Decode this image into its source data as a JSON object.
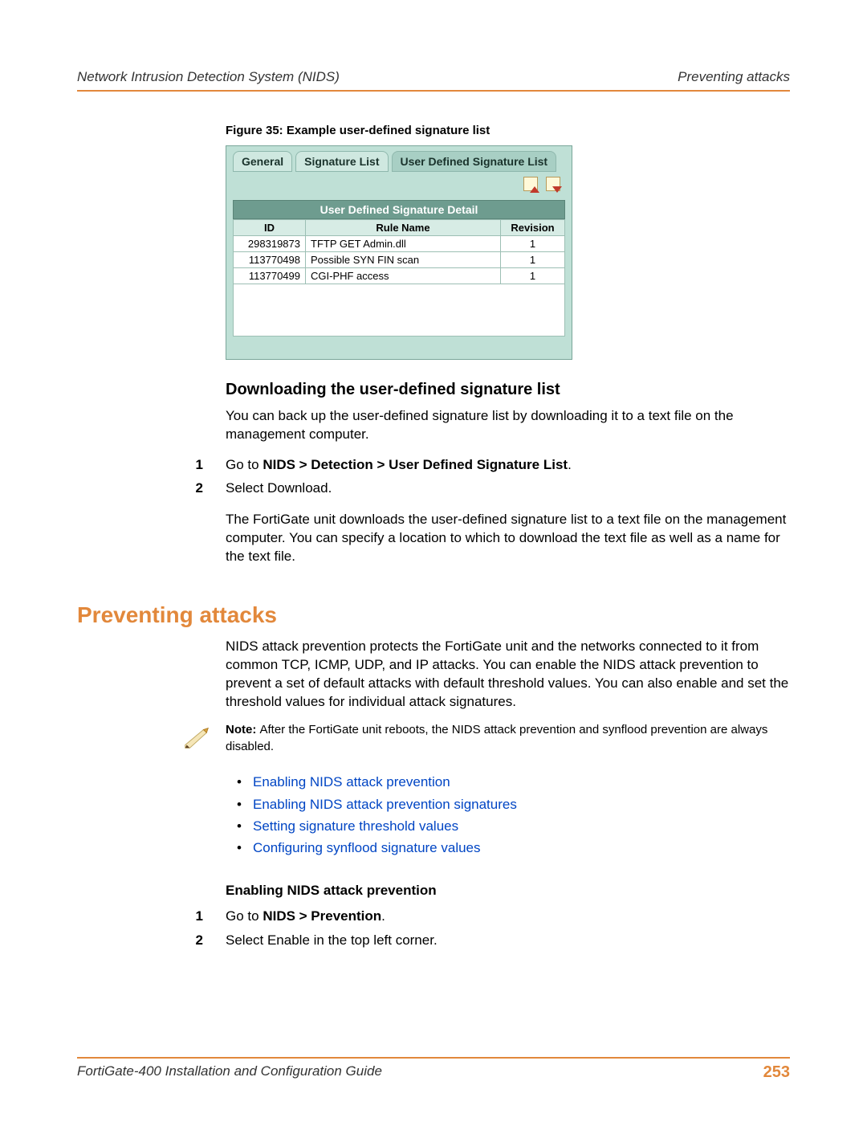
{
  "header": {
    "left": "Network Intrusion Detection System (NIDS)",
    "right": "Preventing attacks"
  },
  "figure": {
    "caption": "Figure 35: Example user-defined signature list",
    "tabs": [
      "General",
      "Signature List",
      "User Defined Signature List"
    ],
    "active_tab_index": 2,
    "table_title": "User Defined Signature Detail",
    "columns": [
      "ID",
      "Rule Name",
      "Revision"
    ],
    "rows": [
      {
        "id": "298319873",
        "name": "TFTP GET Admin.dll",
        "rev": "1"
      },
      {
        "id": "113770498",
        "name": "Possible SYN FIN scan",
        "rev": "1"
      },
      {
        "id": "113770499",
        "name": "CGI-PHF access",
        "rev": "1"
      }
    ]
  },
  "section1": {
    "heading": "Downloading the user-defined signature list",
    "intro": "You can back up the user-defined signature list by downloading it to a text file on the management computer.",
    "step1_prefix": "Go to ",
    "step1_bold": "NIDS > Detection > User Defined Signature List",
    "step1_suffix": ".",
    "step2": "Select Download.",
    "after": "The FortiGate unit downloads the user-defined signature list to a text file on the management computer. You can specify a location to which to download the text file as well as a name for the text file."
  },
  "section2": {
    "heading": "Preventing attacks",
    "intro": "NIDS attack prevention protects the FortiGate unit and the networks connected to it from common TCP, ICMP, UDP, and IP attacks. You can enable the NIDS attack prevention to prevent a set of default attacks with default threshold values. You can also enable and set the threshold values for individual attack signatures.",
    "note_label": "Note: ",
    "note_text": "After the FortiGate unit reboots, the NIDS attack prevention and synflood prevention are always disabled.",
    "links": [
      "Enabling NIDS attack prevention",
      "Enabling NIDS attack prevention signatures",
      "Setting signature threshold values",
      "Configuring synflood signature values"
    ],
    "sub_heading": "Enabling NIDS attack prevention",
    "s2step1_prefix": "Go to ",
    "s2step1_bold": "NIDS > Prevention",
    "s2step1_suffix": ".",
    "s2step2": "Select Enable in the top left corner."
  },
  "footer": {
    "doc_title": "FortiGate-400 Installation and Configuration Guide",
    "page_num": "253"
  },
  "labels": {
    "n1": "1",
    "n2": "2"
  }
}
